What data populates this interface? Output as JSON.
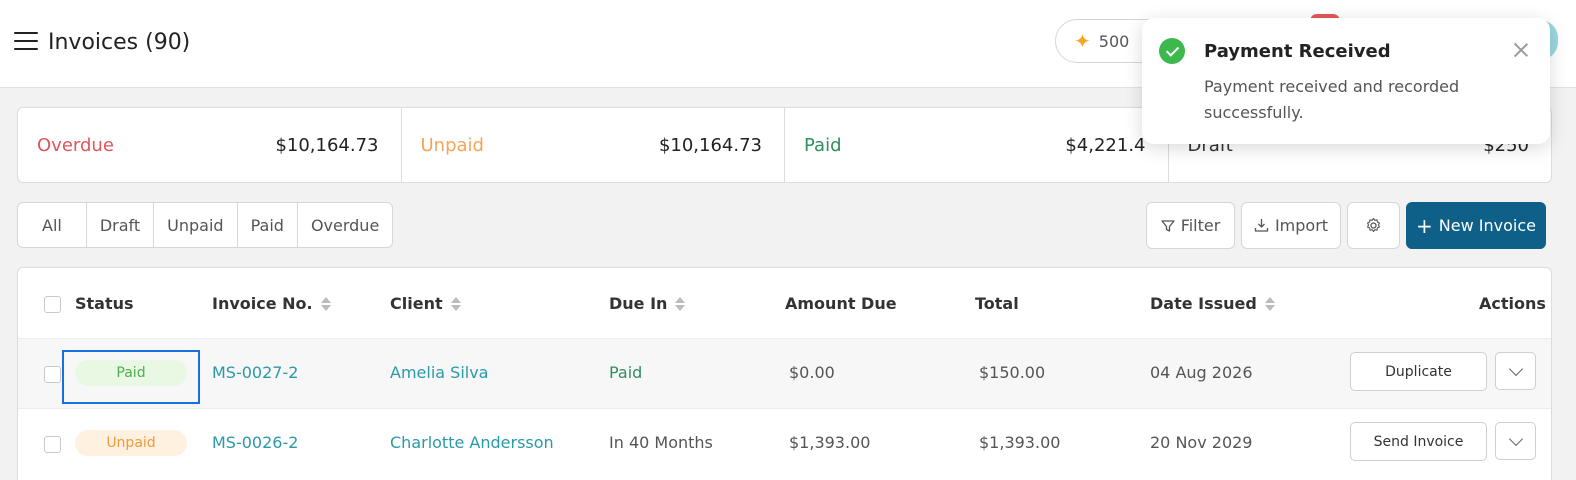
{
  "header": {
    "title": "Invoices (90)",
    "credits": "500"
  },
  "summary": [
    {
      "label": "Overdue",
      "value": "$10,164.73"
    },
    {
      "label": "Unpaid",
      "value": "$10,164.73"
    },
    {
      "label": "Paid",
      "value": "$4,221.4"
    },
    {
      "label": "Draft",
      "value": "$250"
    }
  ],
  "tabs": [
    "All",
    "Draft",
    "Unpaid",
    "Paid",
    "Overdue"
  ],
  "toolbar": {
    "filter": "Filter",
    "import": "Import",
    "new_invoice": "New Invoice"
  },
  "table": {
    "columns": [
      "Status",
      "Invoice No.",
      "Client",
      "Due In",
      "Amount Due",
      "Total",
      "Date Issued",
      "Actions"
    ],
    "rows": [
      {
        "status": "Paid",
        "invoice_no": "MS-0027-2",
        "client": "Amelia Silva",
        "due_in": "Paid",
        "amount_due": "$0.00",
        "total": "$150.00",
        "date_issued": "04 Aug 2026",
        "action": "Duplicate"
      },
      {
        "status": "Unpaid",
        "invoice_no": "MS-0026-2",
        "client": "Charlotte Andersson",
        "due_in": "In 40 Months",
        "amount_due": "$1,393.00",
        "total": "$1,393.00",
        "date_issued": "20 Nov 2029",
        "action": "Send Invoice"
      }
    ]
  },
  "toast": {
    "title": "Payment Received",
    "message": "Payment received and recorded successfully."
  },
  "colors": {
    "primary": "#0e6088",
    "overdue": "#e0555c",
    "unpaid": "#f2a65a",
    "paid": "#2f8f5b",
    "link": "#2a9aa7",
    "success": "#3cb84c"
  }
}
